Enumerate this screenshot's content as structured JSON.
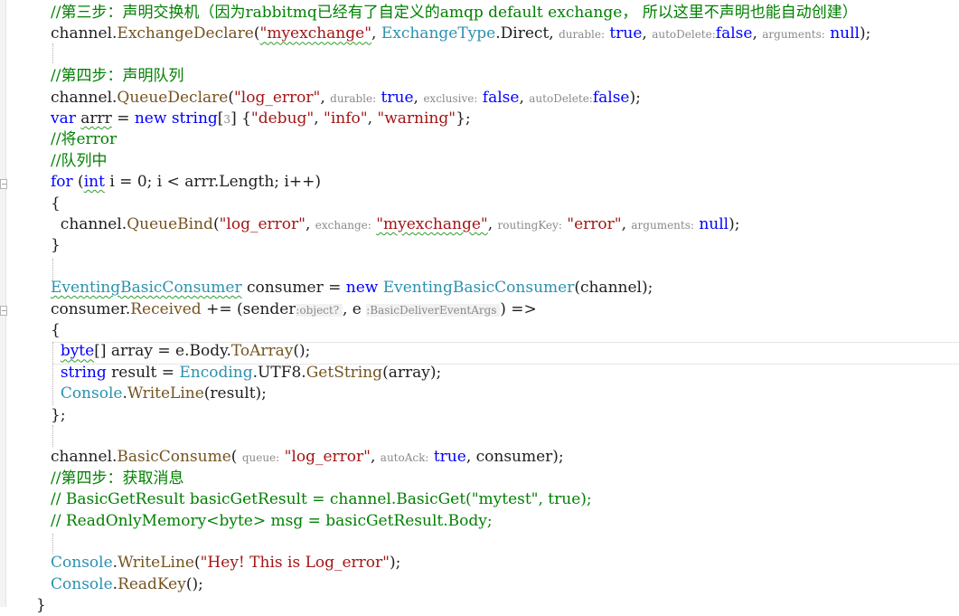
{
  "colors": {
    "comment": "#008000",
    "keyword": "#0000ff",
    "type": "#2b91af",
    "method": "#74531f",
    "string": "#a31515",
    "hint": "#8a8a8a"
  },
  "icons": {
    "fold_collapse": "minus-box-icon"
  },
  "lines": [
    {
      "tokens": [
        {
          "c": "cm",
          "t": "//第三步：声明交换机（因为rabbitmq已经有了自定义的amqp default exchange， 所以这里不声明也能自动创建）"
        }
      ]
    },
    {
      "tokens": [
        {
          "c": "",
          "t": "channel."
        },
        {
          "c": "mt",
          "t": "ExchangeDeclare"
        },
        {
          "c": "",
          "t": "("
        },
        {
          "c": "st squig",
          "t": "\"myexchange\""
        },
        {
          "c": "",
          "t": ", "
        },
        {
          "c": "tp",
          "t": "ExchangeType"
        },
        {
          "c": "",
          "t": ".Direct, "
        },
        {
          "c": "hint",
          "t": "durable:"
        },
        {
          "c": "kw",
          "t": " true"
        },
        {
          "c": "",
          "t": ", "
        },
        {
          "c": "hint",
          "t": "autoDelete:"
        },
        {
          "c": "kw",
          "t": "false"
        },
        {
          "c": "",
          "t": ", "
        },
        {
          "c": "hint",
          "t": "arguments:"
        },
        {
          "c": "kw",
          "t": " null"
        },
        {
          "c": "",
          "t": ");"
        }
      ]
    },
    {
      "tokens": []
    },
    {
      "tokens": [
        {
          "c": "cm",
          "t": "//第四步：声明队列"
        }
      ]
    },
    {
      "tokens": [
        {
          "c": "",
          "t": "channel."
        },
        {
          "c": "mt",
          "t": "QueueDeclare"
        },
        {
          "c": "",
          "t": "("
        },
        {
          "c": "st",
          "t": "\"log_error\""
        },
        {
          "c": "",
          "t": ", "
        },
        {
          "c": "hint",
          "t": "durable:"
        },
        {
          "c": "kw",
          "t": " true"
        },
        {
          "c": "",
          "t": ", "
        },
        {
          "c": "hint",
          "t": "exclusive:"
        },
        {
          "c": "kw",
          "t": " false"
        },
        {
          "c": "",
          "t": ", "
        },
        {
          "c": "hint",
          "t": "autoDelete:"
        },
        {
          "c": "kw",
          "t": "false"
        },
        {
          "c": "",
          "t": ");"
        }
      ]
    },
    {
      "tokens": [
        {
          "c": "kw",
          "t": "var"
        },
        {
          "c": "",
          "t": " "
        },
        {
          "c": "squig",
          "t": "arrr"
        },
        {
          "c": "",
          "t": " = "
        },
        {
          "c": "kw",
          "t": "new"
        },
        {
          "c": "",
          "t": " "
        },
        {
          "c": "kw",
          "t": "string"
        },
        {
          "c": "",
          "t": "["
        },
        {
          "c": "hint",
          "t": "3"
        },
        {
          "c": "",
          "t": "] {"
        },
        {
          "c": "st",
          "t": "\"debug\""
        },
        {
          "c": "",
          "t": ", "
        },
        {
          "c": "st",
          "t": "\"info\""
        },
        {
          "c": "",
          "t": ", "
        },
        {
          "c": "st",
          "t": "\"warning\""
        },
        {
          "c": "",
          "t": "};"
        }
      ]
    },
    {
      "tokens": [
        {
          "c": "cm",
          "t": "//将error"
        }
      ]
    },
    {
      "tokens": [
        {
          "c": "cm",
          "t": "//队列中"
        }
      ]
    },
    {
      "tokens": [
        {
          "c": "kw",
          "t": "for"
        },
        {
          "c": "",
          "t": " ("
        },
        {
          "c": "kw squig",
          "t": "int"
        },
        {
          "c": "",
          "t": " i = 0; i < arrr.Length; i++)"
        }
      ]
    },
    {
      "tokens": [
        {
          "c": "",
          "t": "{"
        }
      ]
    },
    {
      "tokens": [
        {
          "c": "",
          "t": "  channel."
        },
        {
          "c": "mt",
          "t": "QueueBind"
        },
        {
          "c": "",
          "t": "("
        },
        {
          "c": "st",
          "t": "\"log_error\""
        },
        {
          "c": "",
          "t": ", "
        },
        {
          "c": "hint",
          "t": "exchange:"
        },
        {
          "c": "",
          "t": " "
        },
        {
          "c": "st squig",
          "t": "\"myexchange\""
        },
        {
          "c": "",
          "t": ", "
        },
        {
          "c": "hint",
          "t": "routingKey:"
        },
        {
          "c": "st",
          "t": " \"error\""
        },
        {
          "c": "",
          "t": ", "
        },
        {
          "c": "hint",
          "t": "arguments:"
        },
        {
          "c": "kw",
          "t": " null"
        },
        {
          "c": "",
          "t": ");"
        }
      ]
    },
    {
      "tokens": [
        {
          "c": "",
          "t": "}"
        }
      ]
    },
    {
      "tokens": []
    },
    {
      "tokens": [
        {
          "c": "tp squig",
          "t": "EventingBasicConsumer"
        },
        {
          "c": "",
          "t": " consumer = "
        },
        {
          "c": "kw",
          "t": "new"
        },
        {
          "c": "",
          "t": " "
        },
        {
          "c": "tp",
          "t": "EventingBasicConsumer"
        },
        {
          "c": "",
          "t": "(channel);"
        }
      ]
    },
    {
      "tokens": [
        {
          "c": "",
          "t": "consumer."
        },
        {
          "c": "mt",
          "t": "Received"
        },
        {
          "c": "",
          "t": " += (sender"
        },
        {
          "c": "hintbg",
          "t": ":object? "
        },
        {
          "c": "",
          "t": ", e "
        },
        {
          "c": "hintbg",
          "t": ":BasicDeliverEventArgs "
        },
        {
          "c": "",
          "t": ") =>"
        }
      ]
    },
    {
      "tokens": [
        {
          "c": "",
          "t": "{"
        }
      ]
    },
    {
      "tokens": [
        {
          "c": "",
          "t": "  "
        },
        {
          "c": "kw squig",
          "t": "byte"
        },
        {
          "c": "",
          "t": "[] array = e.Body."
        },
        {
          "c": "mt",
          "t": "ToArray"
        },
        {
          "c": "",
          "t": "();"
        }
      ]
    },
    {
      "tokens": [
        {
          "c": "",
          "t": "  "
        },
        {
          "c": "kw",
          "t": "string"
        },
        {
          "c": "",
          "t": " result = "
        },
        {
          "c": "tp",
          "t": "Encoding"
        },
        {
          "c": "",
          "t": ".UTF8."
        },
        {
          "c": "mt",
          "t": "GetString"
        },
        {
          "c": "",
          "t": "(array);"
        }
      ]
    },
    {
      "tokens": [
        {
          "c": "",
          "t": "  "
        },
        {
          "c": "tp",
          "t": "Console"
        },
        {
          "c": "",
          "t": "."
        },
        {
          "c": "mt",
          "t": "WriteLine"
        },
        {
          "c": "",
          "t": "(result);"
        }
      ]
    },
    {
      "tokens": [
        {
          "c": "",
          "t": "};"
        }
      ]
    },
    {
      "tokens": []
    },
    {
      "tokens": [
        {
          "c": "",
          "t": "channel."
        },
        {
          "c": "mt",
          "t": "BasicConsume"
        },
        {
          "c": "",
          "t": "( "
        },
        {
          "c": "hint",
          "t": "queue:"
        },
        {
          "c": "st",
          "t": " \"log_error\""
        },
        {
          "c": "",
          "t": ", "
        },
        {
          "c": "hint",
          "t": "autoAck:"
        },
        {
          "c": "kw",
          "t": " true"
        },
        {
          "c": "",
          "t": ", consumer);"
        }
      ]
    },
    {
      "tokens": [
        {
          "c": "cm",
          "t": "//第四步：获取消息"
        }
      ]
    },
    {
      "tokens": [
        {
          "c": "cm",
          "t": "// BasicGetResult basicGetResult = channel.BasicGet(\"mytest\", true);"
        }
      ]
    },
    {
      "tokens": [
        {
          "c": "cm",
          "t": "// ReadOnlyMemory<byte> msg = basicGetResult.Body;"
        }
      ]
    },
    {
      "tokens": []
    },
    {
      "tokens": [
        {
          "c": "tp",
          "t": "Console"
        },
        {
          "c": "",
          "t": "."
        },
        {
          "c": "mt",
          "t": "WriteLine"
        },
        {
          "c": "",
          "t": "("
        },
        {
          "c": "st",
          "t": "\"Hey! This is Log_error\""
        },
        {
          "c": "",
          "t": ");"
        }
      ]
    },
    {
      "tokens": [
        {
          "c": "tp",
          "t": "Console"
        },
        {
          "c": "",
          "t": "."
        },
        {
          "c": "mt",
          "t": "ReadKey"
        },
        {
          "c": "",
          "t": "();"
        }
      ]
    },
    {
      "tokens": [
        {
          "c": "",
          "t": "}"
        }
      ]
    }
  ]
}
